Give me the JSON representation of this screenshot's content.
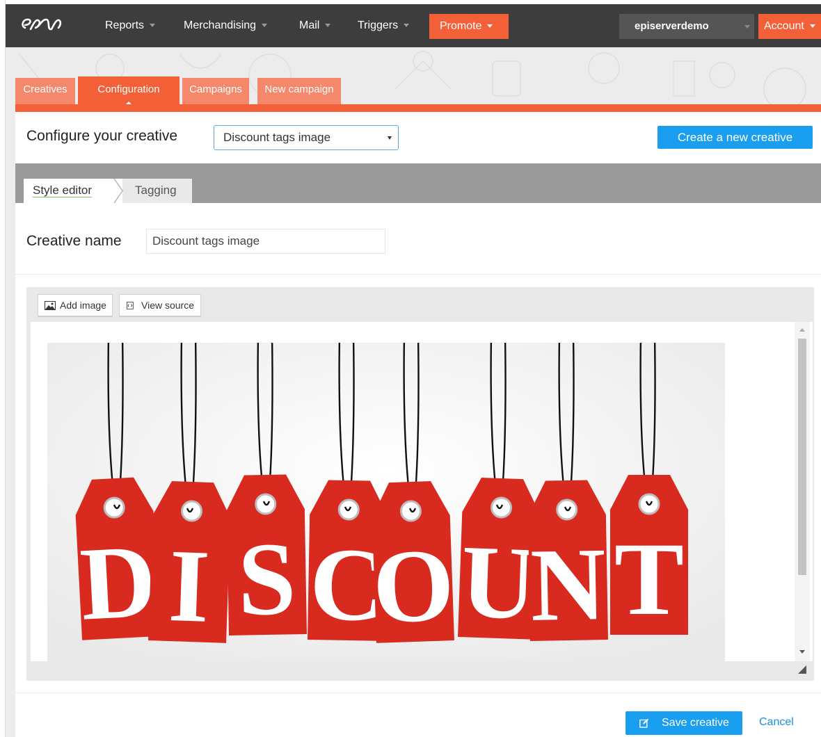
{
  "nav": {
    "items": [
      "Reports",
      "Merchandising",
      "Mail",
      "Triggers"
    ],
    "promote_label": "Promote",
    "site_name": "episerverdemo",
    "account_label": "Account"
  },
  "tabs": [
    "Creatives",
    "Configuration",
    "Campaigns",
    "New campaign"
  ],
  "config": {
    "label": "Configure your creative",
    "selected": "Discount tags image",
    "create_label": "Create a new creative"
  },
  "subtabs": [
    "Style editor",
    "Tagging"
  ],
  "creative": {
    "name_label": "Creative name",
    "name_value": "Discount tags image"
  },
  "toolbar": {
    "add_image": "Add image",
    "view_source": "View source"
  },
  "image": {
    "letters": [
      "D",
      "I",
      "S",
      "C",
      "O",
      "U",
      "N",
      "T"
    ]
  },
  "footer": {
    "save_label": "Save creative",
    "cancel_label": "Cancel"
  },
  "colors": {
    "accent": "#f35f37",
    "primary_blue": "#1a9ef0",
    "nav_bg": "#3d3d3d",
    "tag_red": "#d92a1f"
  }
}
